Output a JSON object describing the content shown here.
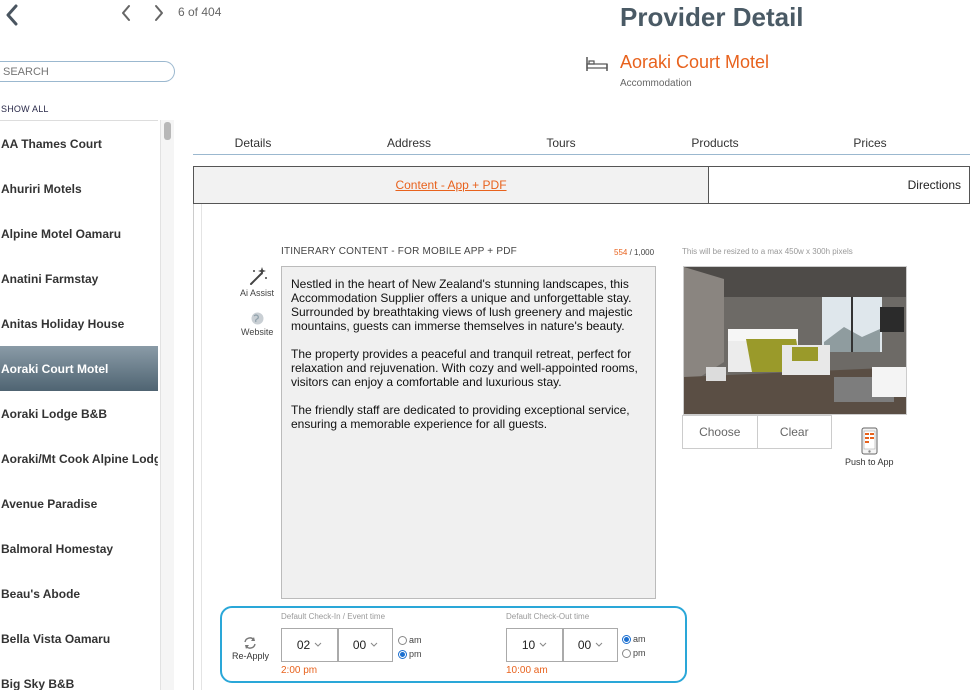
{
  "nav": {
    "pager_text": "6 of 404",
    "search_placeholder": "SEARCH",
    "show_all_label": "SHOW ALL"
  },
  "sidebar": {
    "items": [
      {
        "label": "AA Thames Court",
        "active": false
      },
      {
        "label": "Ahuriri Motels",
        "active": false
      },
      {
        "label": "Alpine Motel Oamaru",
        "active": false
      },
      {
        "label": "Anatini Farmstay",
        "active": false
      },
      {
        "label": "Anitas Holiday House",
        "active": false
      },
      {
        "label": "Aoraki Court Motel",
        "active": true
      },
      {
        "label": "Aoraki Lodge B&B",
        "active": false
      },
      {
        "label": "Aoraki/Mt Cook Alpine Lodge",
        "active": false
      },
      {
        "label": "Avenue Paradise",
        "active": false
      },
      {
        "label": "Balmoral Homestay",
        "active": false
      },
      {
        "label": "Beau's Abode",
        "active": false
      },
      {
        "label": "Bella Vista Oamaru",
        "active": false
      },
      {
        "label": "Big Sky B&B",
        "active": false
      }
    ]
  },
  "header": {
    "title": "Provider Detail",
    "provider_name": "Aoraki Court Motel",
    "provider_type": "Accommodation"
  },
  "tabs": [
    {
      "label": "Details"
    },
    {
      "label": "Address"
    },
    {
      "label": "Tours"
    },
    {
      "label": "Products"
    },
    {
      "label": "Prices"
    }
  ],
  "subtabs": {
    "content": "Content - App + PDF",
    "directions": "Directions"
  },
  "itinerary": {
    "heading": "ITINERARY CONTENT - FOR MOBILE APP + PDF",
    "char_current": "554",
    "char_max": "1,000",
    "text": "Nestled in the heart of New Zealand's stunning landscapes, this Accommodation Supplier offers a unique and unforgettable stay. Surrounded by breathtaking views of lush greenery and majestic mountains, guests can immerse themselves in nature's beauty.\n\nThe property provides a peaceful and tranquil retreat, perfect for relaxation and rejuvenation. With cozy and well-appointed rooms, visitors can enjoy a comfortable and luxurious stay.\n\nThe friendly staff are dedicated to providing exceptional service, ensuring a memorable experience for all guests.",
    "ai_assist_label": "Ai Assist",
    "website_label": "Website"
  },
  "image": {
    "note": "This will be resized to a max 450w x 300h pixels",
    "choose_label": "Choose",
    "clear_label": "Clear",
    "push_label": "Push to App"
  },
  "times": {
    "reapply_label": "Re-Apply",
    "checkin": {
      "label": "Default Check-In / Event time",
      "hour": "02",
      "minute": "00",
      "am_label": "am",
      "pm_label": "pm",
      "selected": "pm",
      "display": "2:00 pm"
    },
    "checkout": {
      "label": "Default Check-Out time",
      "hour": "10",
      "minute": "00",
      "am_label": "am",
      "pm_label": "pm",
      "selected": "am",
      "display": "10:00 am"
    }
  },
  "colors": {
    "accent": "#e8621d",
    "highlight_border": "#2aa7d8",
    "active_item": "#5b6f7c"
  }
}
